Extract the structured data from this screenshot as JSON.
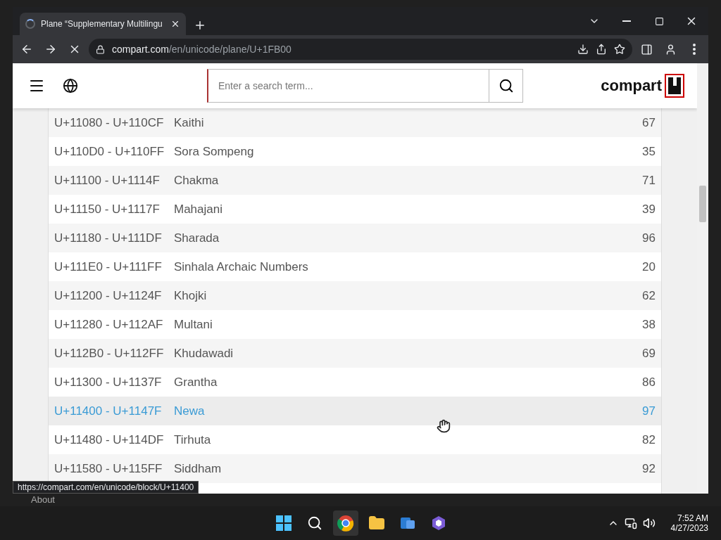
{
  "desktop": {
    "sidebar_label": "About"
  },
  "browser": {
    "tab": {
      "title": "Plane “Supplementary Multilingu",
      "loading": true
    },
    "address": {
      "host": "compart.com",
      "path": "/en/unicode/plane/U+1FB00"
    },
    "status_url": "https://compart.com/en/unicode/block/U+11400"
  },
  "page": {
    "search": {
      "placeholder": "Enter a search term..."
    },
    "logo": "compart",
    "rows": [
      {
        "range": "U+11080 - U+110CF",
        "name": "Kaithi",
        "count": "67",
        "highlighted": false
      },
      {
        "range": "U+110D0 - U+110FF",
        "name": "Sora Sompeng",
        "count": "35",
        "highlighted": false
      },
      {
        "range": "U+11100 - U+1114F",
        "name": "Chakma",
        "count": "71",
        "highlighted": false
      },
      {
        "range": "U+11150 - U+1117F",
        "name": "Mahajani",
        "count": "39",
        "highlighted": false
      },
      {
        "range": "U+11180 - U+111DF",
        "name": "Sharada",
        "count": "96",
        "highlighted": false
      },
      {
        "range": "U+111E0 - U+111FF",
        "name": "Sinhala Archaic Numbers",
        "count": "20",
        "highlighted": false
      },
      {
        "range": "U+11200 - U+1124F",
        "name": "Khojki",
        "count": "62",
        "highlighted": false
      },
      {
        "range": "U+11280 - U+112AF",
        "name": "Multani",
        "count": "38",
        "highlighted": false
      },
      {
        "range": "U+112B0 - U+112FF",
        "name": "Khudawadi",
        "count": "69",
        "highlighted": false
      },
      {
        "range": "U+11300 - U+1137F",
        "name": "Grantha",
        "count": "86",
        "highlighted": false
      },
      {
        "range": "U+11400 - U+1147F",
        "name": "Newa",
        "count": "97",
        "highlighted": true
      },
      {
        "range": "U+11480 - U+114DF",
        "name": "Tirhuta",
        "count": "82",
        "highlighted": false
      },
      {
        "range": "U+11580 - U+115FF",
        "name": "Siddham",
        "count": "92",
        "highlighted": false
      }
    ]
  },
  "taskbar": {
    "time": "7:52 AM",
    "date": "4/27/2023"
  }
}
